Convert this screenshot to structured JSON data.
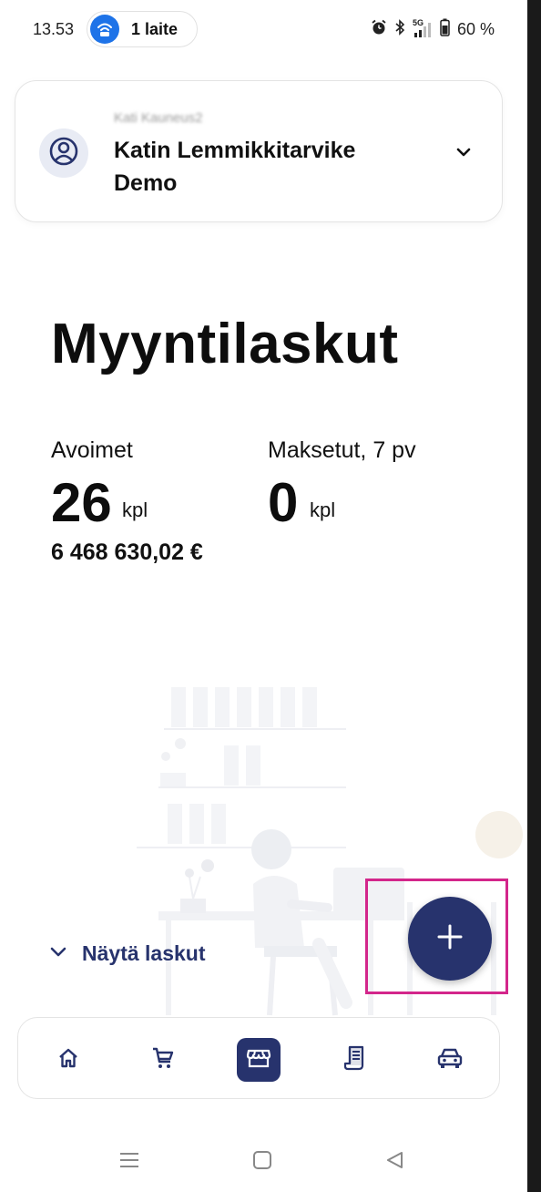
{
  "status_bar": {
    "time": "13.53",
    "devices_label": "1 laite",
    "network": "5G",
    "battery": "60 %",
    "icons": [
      "wifi-hotspot-icon",
      "alarm-icon",
      "bluetooth-icon",
      "signal-icon",
      "battery-icon"
    ]
  },
  "account": {
    "user_name": "Kati Kauneus2",
    "company": "Katin Lemmikkitarvike Demo",
    "icons": [
      "user-circle-icon",
      "chevron-down-icon"
    ]
  },
  "page": {
    "title": "Myyntilaskut"
  },
  "stats": {
    "open": {
      "label": "Avoimet",
      "count": "26",
      "unit": "kpl",
      "amount": "6 468 630,02 €"
    },
    "paid": {
      "label": "Maksetut, 7 pv",
      "count": "0",
      "unit": "kpl"
    }
  },
  "actions": {
    "show_invoices": "Näytä laskut",
    "add_icon": "plus-icon"
  },
  "bottom_nav": {
    "items": [
      {
        "name": "home",
        "icon": "home-icon",
        "active": false
      },
      {
        "name": "cart",
        "icon": "cart-icon",
        "active": false
      },
      {
        "name": "store",
        "icon": "store-icon",
        "active": true
      },
      {
        "name": "receipt",
        "icon": "receipt-icon",
        "active": false
      },
      {
        "name": "car",
        "icon": "car-icon",
        "active": false
      }
    ]
  },
  "colors": {
    "primary": "#27336d",
    "highlight": "#d3268b",
    "hotspot_blue": "#1e73e8"
  }
}
